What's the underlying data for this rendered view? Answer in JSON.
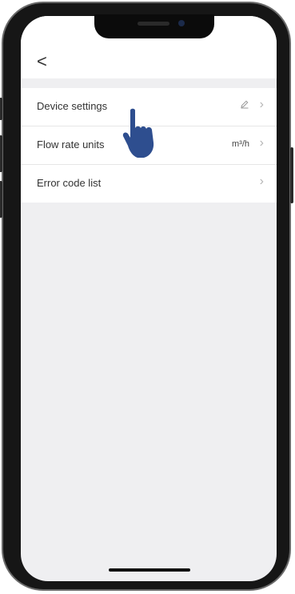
{
  "nav": {
    "back_icon": "chevron-left-icon",
    "back_glyph": "<"
  },
  "settings": {
    "items": [
      {
        "label": "Device settings",
        "value": "",
        "icon": "edit-icon"
      },
      {
        "label": "Flow rate units",
        "value": "m³/h"
      },
      {
        "label": "Error code list",
        "value": ""
      }
    ]
  },
  "overlay": {
    "pointer_icon": "pointing-hand-icon",
    "pointer_color": "#2e4e8f"
  }
}
